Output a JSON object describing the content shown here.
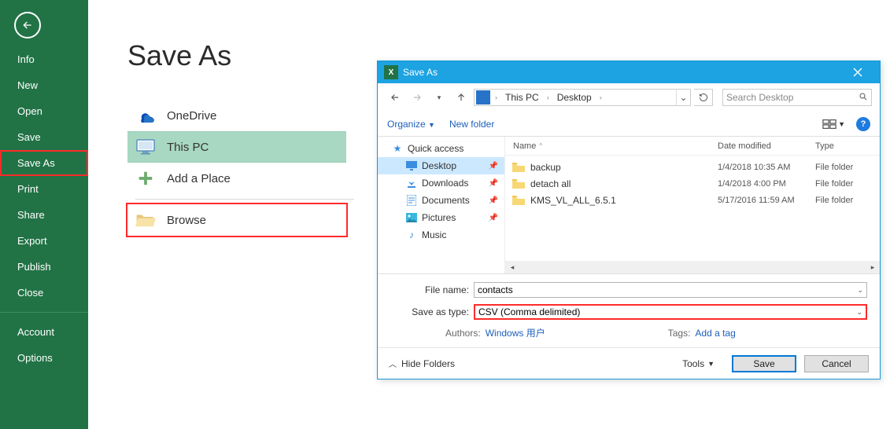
{
  "sidebar": {
    "items": [
      "Info",
      "New",
      "Open",
      "Save",
      "Save As",
      "Print",
      "Share",
      "Export",
      "Publish",
      "Close"
    ],
    "footer": [
      "Account",
      "Options"
    ]
  },
  "page": {
    "title": "Save As",
    "places": {
      "onedrive": "OneDrive",
      "thispc": "This PC",
      "addplace": "Add a Place",
      "browse": "Browse"
    }
  },
  "dialog": {
    "title": "Save As",
    "breadcrumb": {
      "root": "This PC",
      "leaf": "Desktop"
    },
    "toolbar": {
      "organize": "Organize",
      "newfolder": "New folder"
    },
    "search_placeholder": "Search Desktop",
    "tree": {
      "quick": "Quick access",
      "desktop": "Desktop",
      "downloads": "Downloads",
      "documents": "Documents",
      "pictures": "Pictures",
      "music": "Music"
    },
    "columns": {
      "name": "Name",
      "date": "Date modified",
      "type": "Type"
    },
    "rows": [
      {
        "name": "backup",
        "date": "1/4/2018 10:35 AM",
        "type": "File folder"
      },
      {
        "name": "detach all",
        "date": "1/4/2018 4:00 PM",
        "type": "File folder"
      },
      {
        "name": "KMS_VL_ALL_6.5.1",
        "date": "5/17/2016 11:59 AM",
        "type": "File folder"
      }
    ],
    "form": {
      "filenameLabel": "File name:",
      "filenameValue": "contacts",
      "typeLabel": "Save as type:",
      "typeValue": "CSV (Comma delimited)",
      "authorsLabel": "Authors:",
      "authorsValue": "Windows 用户",
      "tagsLabel": "Tags:",
      "tagsValue": "Add a tag"
    },
    "buttons": {
      "hide": "Hide Folders",
      "tools": "Tools",
      "save": "Save",
      "cancel": "Cancel"
    }
  }
}
